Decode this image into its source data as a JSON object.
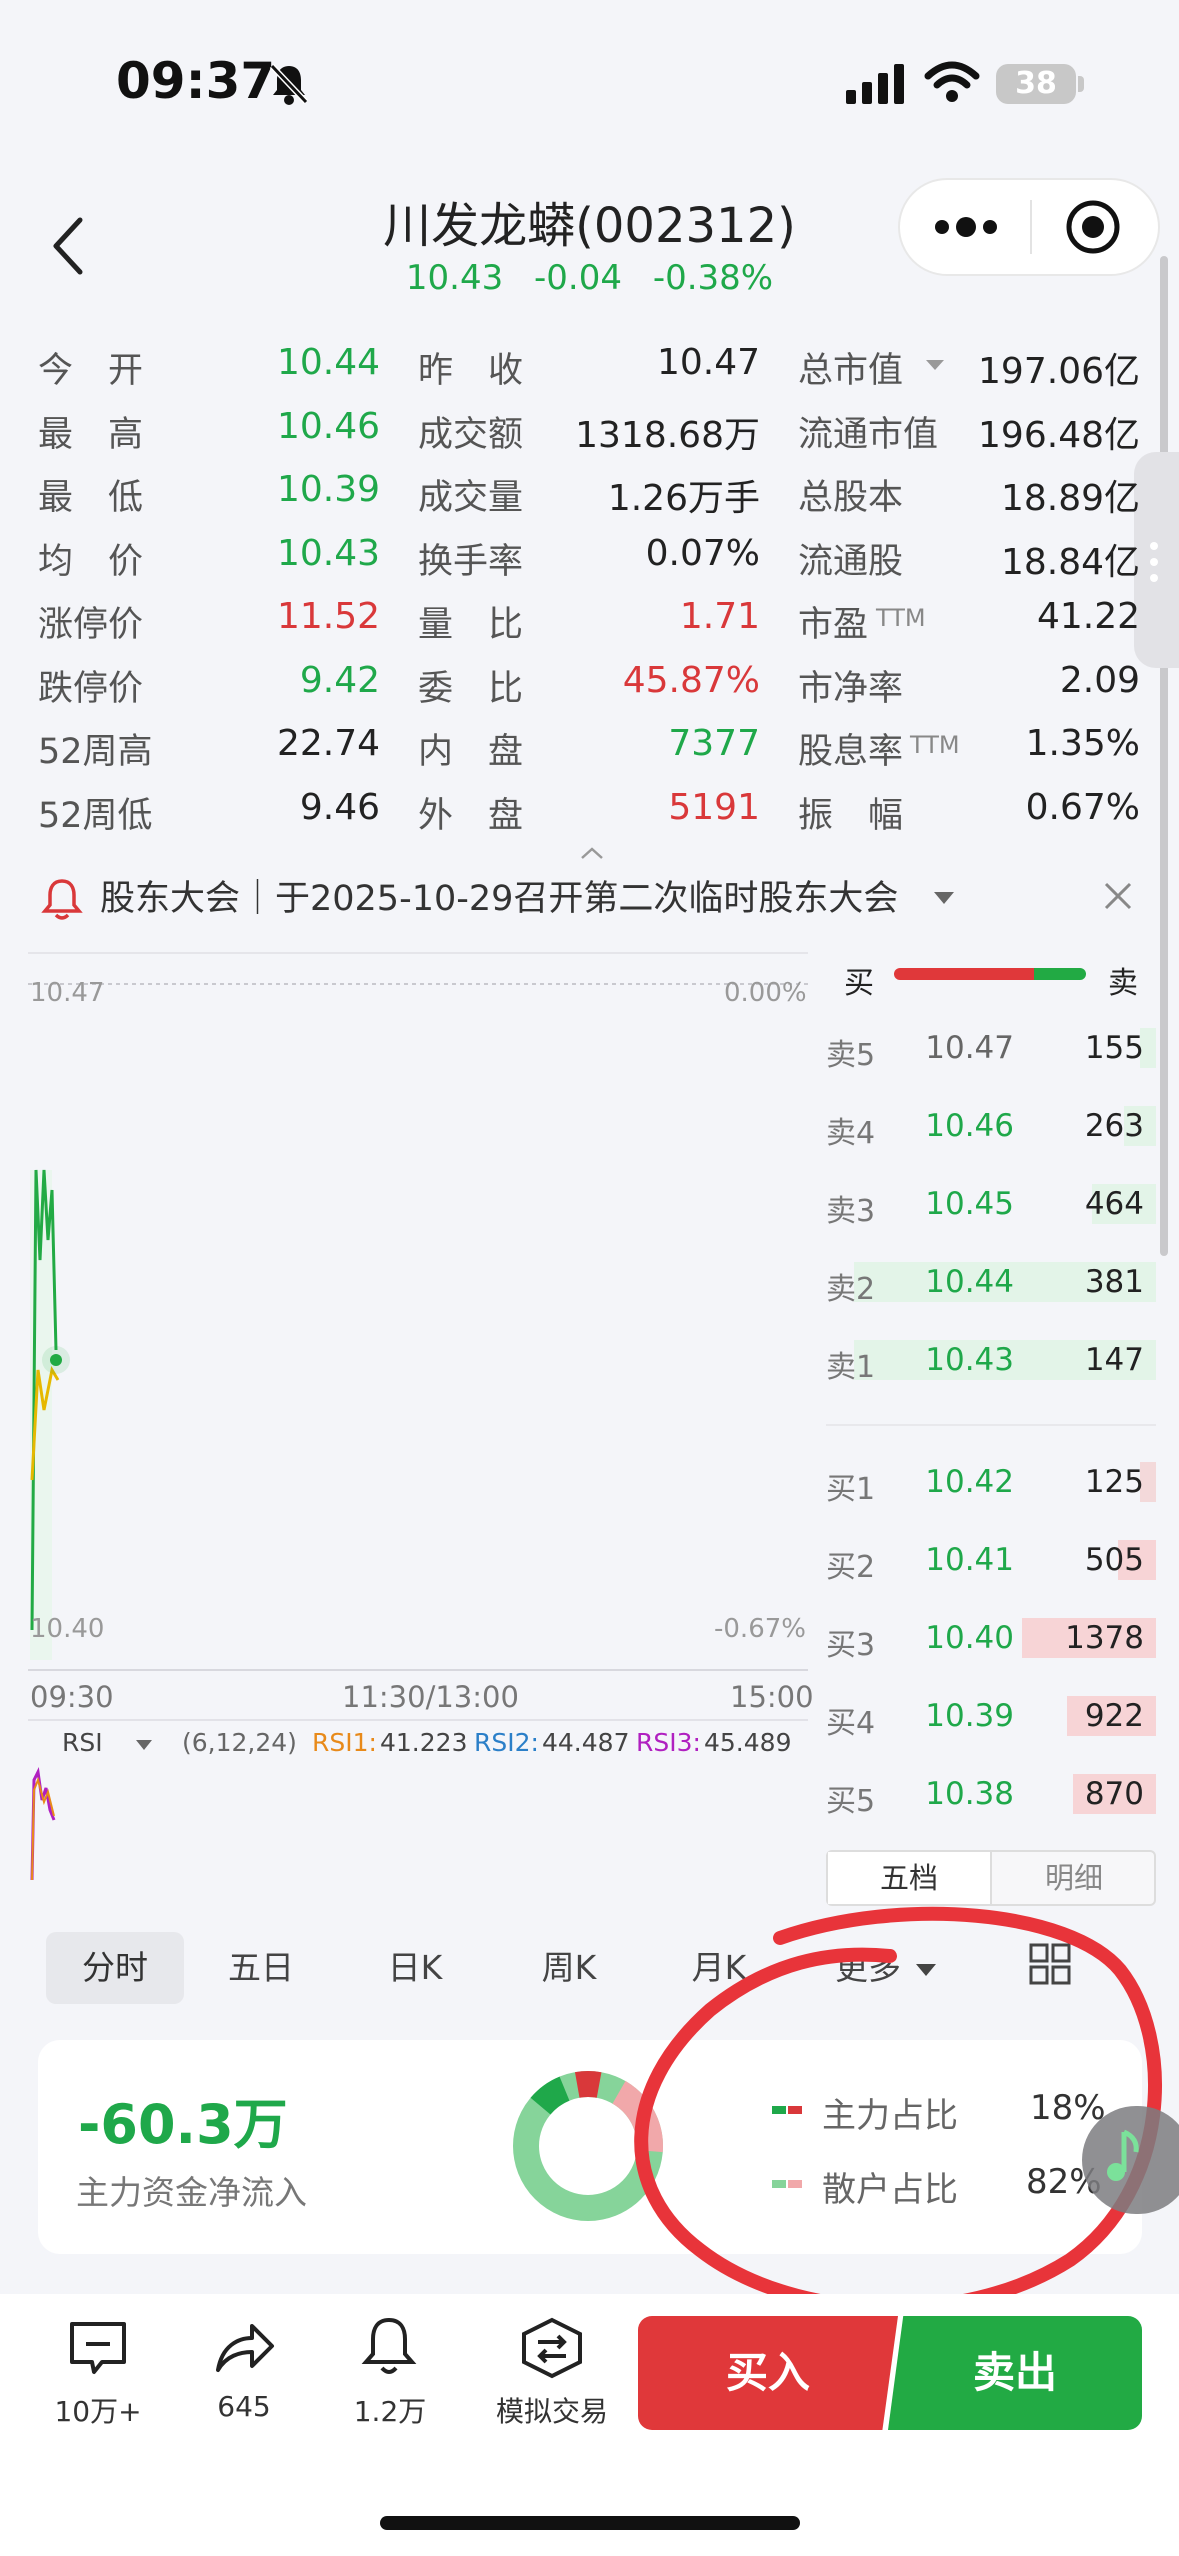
{
  "status": {
    "time": "09:37",
    "battery": "38"
  },
  "header": {
    "title": "川发龙蟒(002312)",
    "price": "10.43",
    "change": "-0.04",
    "pct": "-0.38%"
  },
  "quote": {
    "col1": [
      {
        "label": "今　开",
        "value": "10.44",
        "color": "green"
      },
      {
        "label": "最　高",
        "value": "10.46",
        "color": "green"
      },
      {
        "label": "最　低",
        "value": "10.39",
        "color": "green"
      },
      {
        "label": "均　价",
        "value": "10.43",
        "color": "green"
      },
      {
        "label": "涨停价",
        "value": "11.52",
        "color": "red"
      },
      {
        "label": "跌停价",
        "value": "9.42",
        "color": "green"
      },
      {
        "label": "52周高",
        "value": "22.74",
        "color": "dark"
      },
      {
        "label": "52周低",
        "value": "9.46",
        "color": "dark"
      }
    ],
    "col2": [
      {
        "label": "昨　收",
        "value": "10.47",
        "color": "dark"
      },
      {
        "label": "成交额",
        "value": "1318.68万",
        "color": "dark"
      },
      {
        "label": "成交量",
        "value": "1.26万手",
        "color": "dark"
      },
      {
        "label": "换手率",
        "value": "0.07%",
        "color": "dark"
      },
      {
        "label": "量　比",
        "value": "1.71",
        "color": "red"
      },
      {
        "label": "委　比",
        "value": "45.87%",
        "color": "red"
      },
      {
        "label": "内　盘",
        "value": "7377",
        "color": "green"
      },
      {
        "label": "外　盘",
        "value": "5191",
        "color": "red"
      }
    ],
    "col3": [
      {
        "label": "总市值",
        "value": "197.06亿",
        "color": "dark"
      },
      {
        "label": "流通市值",
        "value": "196.48亿",
        "color": "dark"
      },
      {
        "label": "总股本",
        "value": "18.89亿",
        "color": "dark"
      },
      {
        "label": "流通股",
        "value": "18.84亿",
        "color": "dark"
      },
      {
        "label": "市盈",
        "value": "41.22",
        "color": "dark"
      },
      {
        "label": "市净率",
        "value": "2.09",
        "color": "dark"
      },
      {
        "label": "股息率",
        "value": "1.35%",
        "color": "dark"
      },
      {
        "label": "振　幅",
        "value": "0.67%",
        "color": "dark"
      }
    ],
    "ttm": "TTM"
  },
  "notice": {
    "text": "股东大会｜于2025-10-29召开第二次临时股东大会"
  },
  "chart": {
    "price_top": "10.47",
    "price_bottom": "10.40",
    "pct_top": "0.00%",
    "pct_bottom": "-0.67%",
    "time_start": "09:30",
    "time_mid": "11:30/13:00",
    "time_end": "15:00"
  },
  "rsi": {
    "name": "RSI",
    "params": "(6,12,24)",
    "rsi1_label": "RSI1:",
    "rsi1": "41.223",
    "rsi2_label": "RSI2:",
    "rsi2": "44.487",
    "rsi3_label": "RSI3:",
    "rsi3": "45.489"
  },
  "orderbook": {
    "head_buy": "买",
    "head_sell": "卖",
    "asks": [
      {
        "label": "卖5",
        "price": "10.47",
        "vol": "155",
        "color": "gray",
        "bar": 0.05
      },
      {
        "label": "卖4",
        "price": "10.46",
        "vol": "263",
        "color": "green",
        "bar": 0.1
      },
      {
        "label": "卖3",
        "price": "10.45",
        "vol": "464",
        "color": "green",
        "bar": 0.2
      },
      {
        "label": "卖2",
        "price": "10.44",
        "vol": "381",
        "color": "green",
        "bar": 0.95
      },
      {
        "label": "卖1",
        "price": "10.43",
        "vol": "147",
        "color": "green",
        "bar": 0.95
      }
    ],
    "bids": [
      {
        "label": "买1",
        "price": "10.42",
        "vol": "125",
        "color": "green",
        "bar": 0.05
      },
      {
        "label": "买2",
        "price": "10.41",
        "vol": "505",
        "color": "green",
        "bar": 0.12
      },
      {
        "label": "买3",
        "price": "10.40",
        "vol": "1378",
        "color": "green",
        "bar": 0.42
      },
      {
        "label": "买4",
        "price": "10.39",
        "vol": "922",
        "color": "green",
        "bar": 0.28
      },
      {
        "label": "买5",
        "price": "10.38",
        "vol": "870",
        "color": "green",
        "bar": 0.26
      }
    ],
    "tab_five": "五档",
    "tab_detail": "明细"
  },
  "periods": [
    "分时",
    "五日",
    "日K",
    "周K",
    "月K",
    "更多"
  ],
  "fund": {
    "net_inflow": "-60.3万",
    "net_label": "主力资金净流入",
    "main_label": "主力占比",
    "main_pct": "18%",
    "retail_label": "散户占比",
    "retail_pct": "82%"
  },
  "bottom": {
    "comments": "10万+",
    "shares": "645",
    "alerts": "1.2万",
    "sim": "模拟交易",
    "buy": "买入",
    "sell": "卖出"
  },
  "colors": {
    "green": "#1fa84a",
    "red": "#d9383a",
    "annotation": "#e8343a"
  }
}
